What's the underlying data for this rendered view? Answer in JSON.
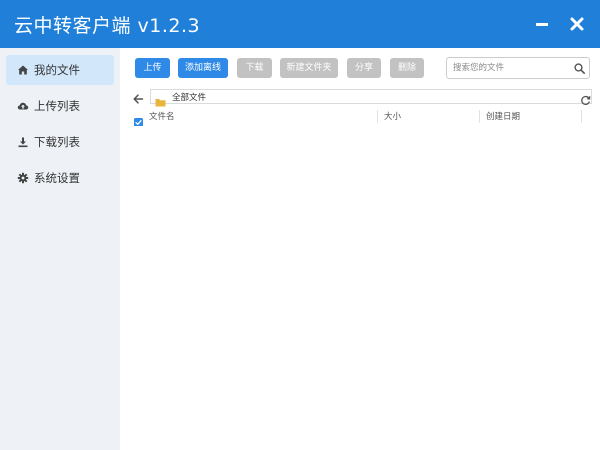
{
  "window": {
    "title": "云中转客户端 v1.2.3",
    "accent_color": "#1f7fd9"
  },
  "sidebar": {
    "items": [
      {
        "label": "我的文件",
        "icon": "home-icon",
        "active": true
      },
      {
        "label": "上传列表",
        "icon": "cloud-upload-icon",
        "active": false
      },
      {
        "label": "下载列表",
        "icon": "download-icon",
        "active": false
      },
      {
        "label": "系统设置",
        "icon": "gear-icon",
        "active": false
      }
    ]
  },
  "toolbar": {
    "upload_label": "上传",
    "offline_label": "添加离线",
    "download_label": "下载",
    "new_folder_label": "新建文件夹",
    "share_label": "分享",
    "delete_label": "删除"
  },
  "search": {
    "placeholder": "搜索您的文件"
  },
  "path": {
    "current": "全部文件"
  },
  "list": {
    "columns": [
      "文件名",
      "大小",
      "创建日期"
    ],
    "rows": []
  }
}
